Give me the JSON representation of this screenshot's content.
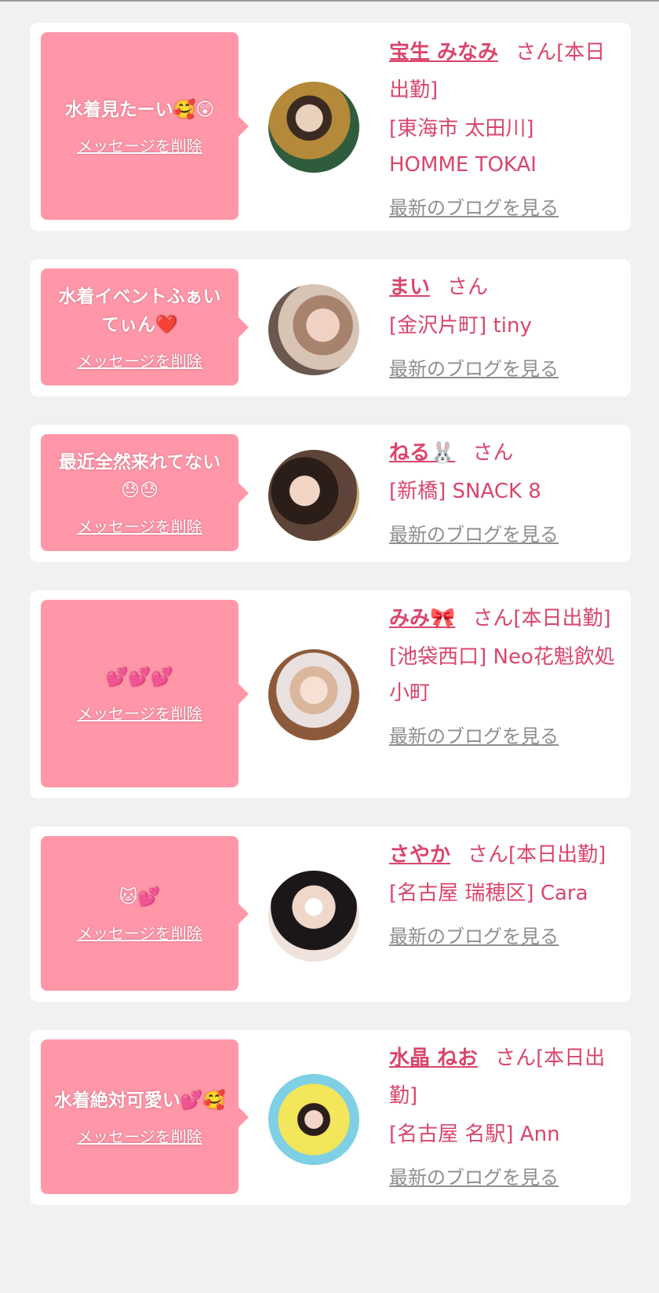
{
  "delete_label": "メッセージを削除",
  "blog_label": "最新のブログを見る",
  "cards": [
    {
      "message": "水着見たーい🥰😲",
      "name": "宝生 みなみ",
      "san": "さん[本日出勤]",
      "shop": "[東海市 太田川] HOMME TOKAI"
    },
    {
      "message": "水着イベントふぁいてぃん❤️",
      "name": "まい",
      "san": "さん",
      "shop": "[金沢片町] tiny"
    },
    {
      "message": "最近全然来れてない😓😓",
      "name": "ねる🐰",
      "san": "さん",
      "shop": "[新橋] SNACK 8"
    },
    {
      "message": "💕💕💕",
      "name": "みみ🎀",
      "san": "さん[本日出勤]",
      "shop": "[池袋西口] Neo花魁飲処 小町"
    },
    {
      "message": "🐱💕",
      "name": "さやか",
      "san": "さん[本日出勤]",
      "shop": "[名古屋 瑞穂区] Cara"
    },
    {
      "message": "水着絶対可愛い💕🥰",
      "name": "水晶 ねお",
      "san": "さん[本日出勤]",
      "shop": "[名古屋 名駅] Ann"
    }
  ],
  "colors": {
    "background": "#f1f1f1",
    "bubble": "#ff97a9",
    "name": "#d9466c",
    "blog": "#8e8e8e"
  }
}
